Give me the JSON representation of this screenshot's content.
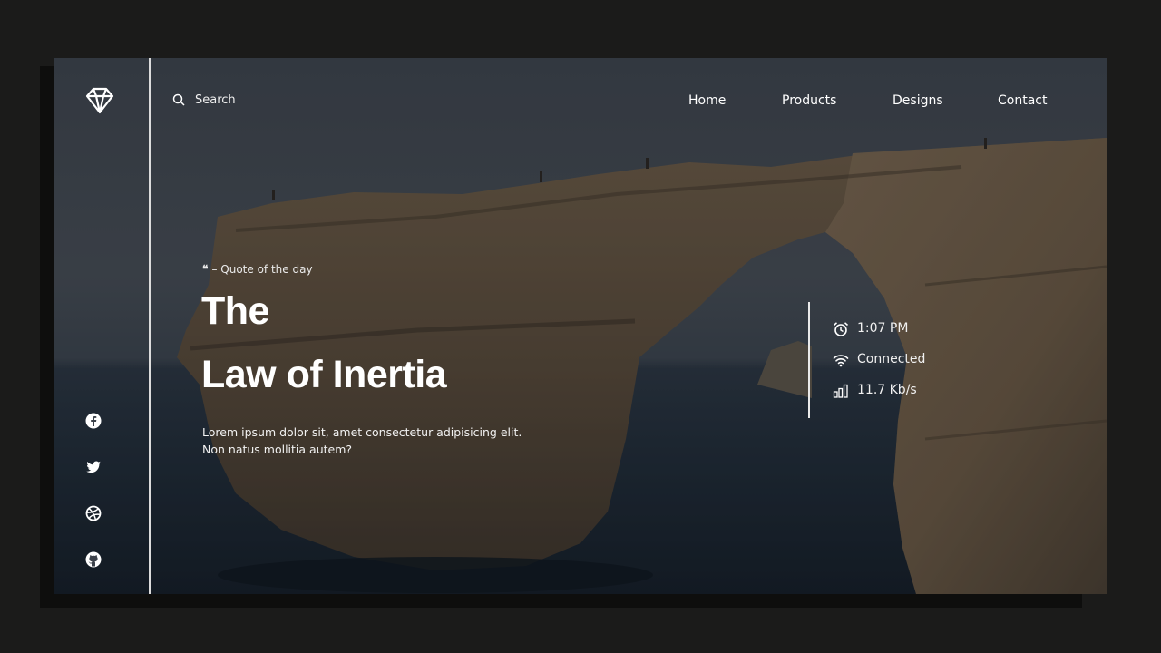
{
  "brand": {
    "logo_icon": "diamond-icon"
  },
  "search": {
    "placeholder": "Search"
  },
  "nav": {
    "items": [
      "Home",
      "Products",
      "Designs",
      "Contact"
    ]
  },
  "social": [
    "facebook-icon",
    "twitter-icon",
    "dribbble-icon",
    "github-icon"
  ],
  "hero": {
    "quote_label": "– Quote of the day",
    "title_line1": "The",
    "title_line2": "Law of Inertia",
    "description_line1": "Lorem ipsum dolor sit, amet consectetur adipisicing elit.",
    "description_line2": "Non natus mollitia autem?"
  },
  "status": {
    "time": "1:07 PM",
    "connection": "Connected",
    "speed": "11.7 Kb/s"
  },
  "colors": {
    "page_bg": "#1b1b1a",
    "text": "#ffffff",
    "rock": "#7a6650",
    "sea": "#1f2a36"
  }
}
